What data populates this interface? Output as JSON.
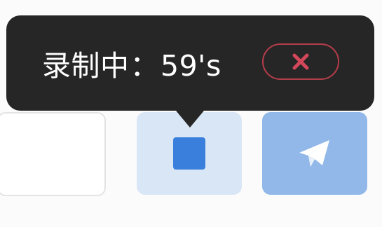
{
  "recording": {
    "label": "录制中",
    "separator": "：",
    "elapsed": "59's"
  },
  "cancel_button": {
    "icon": "close-icon"
  },
  "stop_button": {
    "icon": "stop-square-icon"
  },
  "send_button": {
    "icon": "paper-plane-icon"
  },
  "colors": {
    "tooltip_bg": "#262626",
    "cancel_accent": "#d2475a",
    "stop_bg": "#d9e6f5",
    "stop_square": "#3a7fdc",
    "send_bg": "#91b8e8"
  }
}
